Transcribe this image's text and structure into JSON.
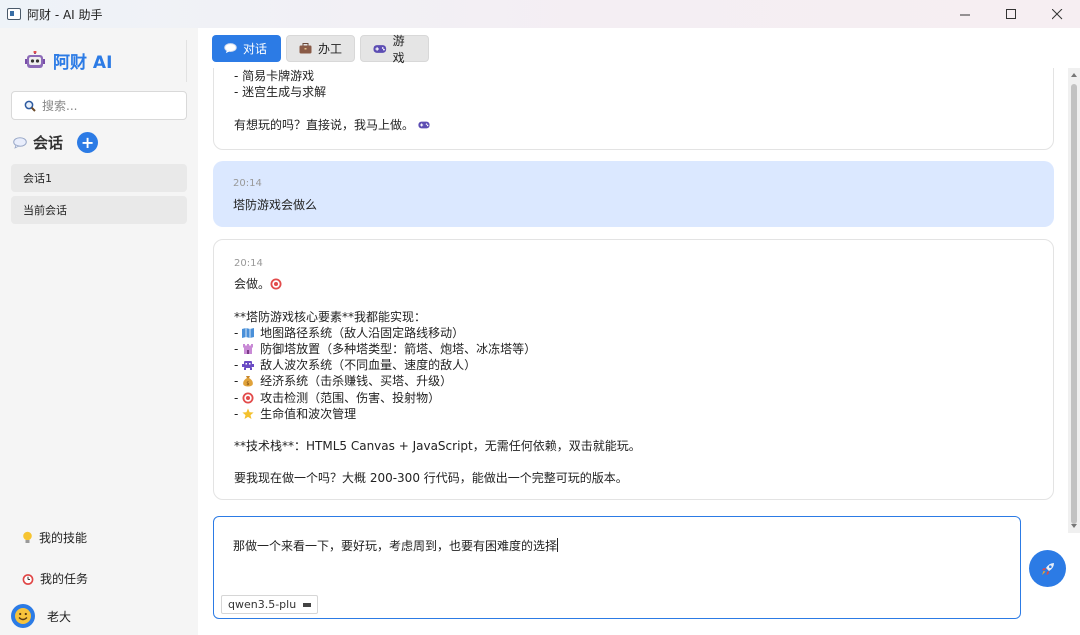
{
  "window": {
    "title": "阿财 - AI 助手"
  },
  "sidebar": {
    "brand": "阿财 AI",
    "search_placeholder": "搜索...",
    "conversations_title": "会话",
    "add_label": "+",
    "conversations": [
      "会话1",
      "当前会话"
    ],
    "footer": {
      "skills": "我的技能",
      "tasks": "我的任务",
      "user": "老大"
    }
  },
  "tabs": [
    {
      "label": "对话",
      "icon": "speech-bubble-icon",
      "active": true
    },
    {
      "label": "办工",
      "icon": "briefcase-icon",
      "active": false
    },
    {
      "label": "游戏",
      "icon": "gamepad-icon",
      "active": false
    }
  ],
  "messages": [
    {
      "role": "ai",
      "lines": [
        {
          "text": "- 简易卡牌游戏"
        },
        {
          "text": "- 迷宫生成与求解"
        },
        {
          "text": ""
        },
        {
          "text": "有想玩的吗？直接说，我马上做。",
          "trailing_icon": "gamepad-icon"
        }
      ]
    },
    {
      "role": "user",
      "time": "20:14",
      "lines": [
        {
          "text": "塔防游戏会做么"
        }
      ]
    },
    {
      "role": "ai",
      "time": "20:14",
      "lines": [
        {
          "text": "会做。",
          "trailing_icon": "target-icon"
        },
        {
          "text": ""
        },
        {
          "text": "**塔防游戏核心要素**我都能实现："
        },
        {
          "text": "地图路径系统（敌人沿固定路线移动）",
          "prefix": "- ",
          "icon": "map-icon"
        },
        {
          "text": "防御塔放置（多种塔类型：箭塔、炮塔、冰冻塔等）",
          "prefix": "- ",
          "icon": "castle-icon"
        },
        {
          "text": "敌人波次系统（不同血量、速度的敌人）",
          "prefix": "- ",
          "icon": "monster-icon"
        },
        {
          "text": "经济系统（击杀赚钱、买塔、升级）",
          "prefix": "- ",
          "icon": "money-bag-icon"
        },
        {
          "text": "攻击检测（范围、伤害、投射物）",
          "prefix": "- ",
          "icon": "target-icon"
        },
        {
          "text": "生命值和波次管理",
          "prefix": "- ",
          "icon": "star-icon"
        },
        {
          "text": ""
        },
        {
          "text": "**技术栈**：HTML5 Canvas + JavaScript，无需任何依赖，双击就能玩。"
        },
        {
          "text": ""
        },
        {
          "text": "要我现在做一个吗？大概 200-300 行代码，能做出一个完整可玩的版本。"
        }
      ]
    }
  ],
  "input": {
    "value": "那做一个来看一下，要好玩，考虑周到，也要有困难度的选择",
    "model": "qwen3.5-plu"
  },
  "colors": {
    "accent": "#2c7be5",
    "user_bubble": "#dbe8ff",
    "sidebar_bg": "#f5f5f5"
  }
}
